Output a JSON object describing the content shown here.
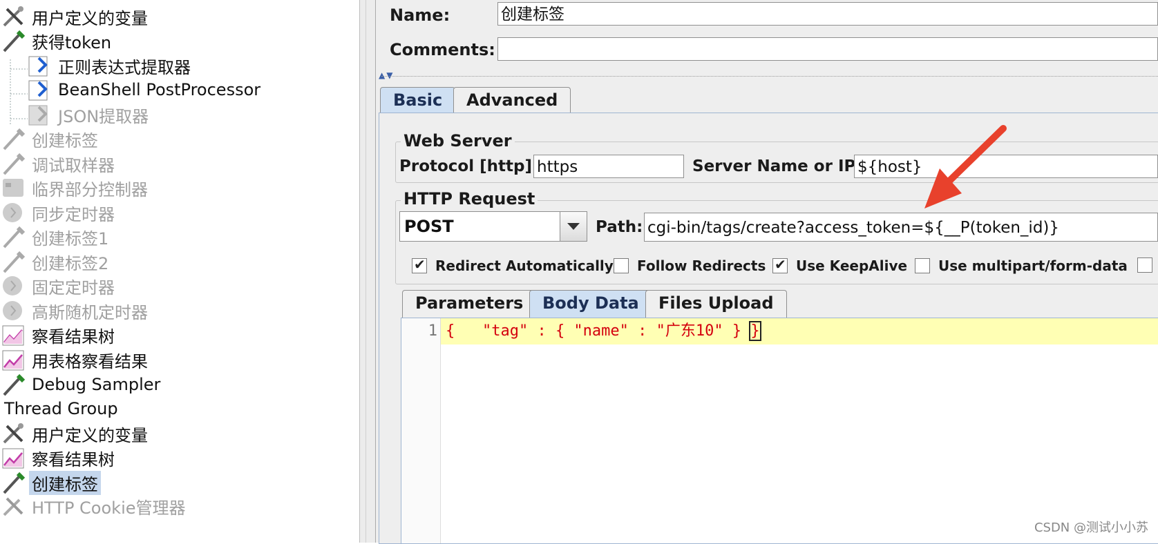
{
  "tree": {
    "items": [
      {
        "label": "用户定义的变量",
        "icon": "wrench-screwdriver-icon",
        "state": "normal"
      },
      {
        "label": "获得token",
        "icon": "pipette-sampler-icon",
        "state": "normal"
      },
      {
        "label": "正则表达式提取器",
        "icon": "post-processor-icon",
        "state": "normal"
      },
      {
        "label": "BeanShell PostProcessor",
        "icon": "post-processor-icon",
        "state": "normal"
      },
      {
        "label": "JSON提取器",
        "icon": "post-processor-icon",
        "state": "disabled"
      },
      {
        "label": "创建标签",
        "icon": "pipette-sampler-icon",
        "state": "disabled"
      },
      {
        "label": "调试取样器",
        "icon": "pipette-sampler-icon",
        "state": "disabled"
      },
      {
        "label": "临界部分控制器",
        "icon": "controller-icon",
        "state": "disabled"
      },
      {
        "label": "同步定时器",
        "icon": "timer-icon",
        "state": "disabled"
      },
      {
        "label": "创建标签1",
        "icon": "pipette-sampler-icon",
        "state": "disabled"
      },
      {
        "label": "创建标签2",
        "icon": "pipette-sampler-icon",
        "state": "disabled"
      },
      {
        "label": "固定定时器",
        "icon": "timer-icon",
        "state": "disabled"
      },
      {
        "label": "高斯随机定时器",
        "icon": "timer-icon",
        "state": "disabled"
      },
      {
        "label": "察看结果树",
        "icon": "chart-listener-icon",
        "state": "normal"
      },
      {
        "label": "用表格察看结果",
        "icon": "chart-listener-icon",
        "state": "normal"
      },
      {
        "label": "Debug Sampler",
        "icon": "pipette-sampler-icon",
        "state": "normal"
      },
      {
        "label": "Thread Group",
        "icon": "",
        "state": "normal"
      },
      {
        "label": "用户定义的变量",
        "icon": "wrench-screwdriver-icon",
        "state": "normal"
      },
      {
        "label": "察看结果树",
        "icon": "chart-listener-icon",
        "state": "normal"
      },
      {
        "label": "创建标签",
        "icon": "pipette-sampler-icon",
        "state": "selected"
      },
      {
        "label": "HTTP Cookie管理器",
        "icon": "wrench-screwdriver-icon",
        "state": "disabled"
      }
    ]
  },
  "form": {
    "name_label": "Name:",
    "name_value": "创建标签",
    "comments_label": "Comments:",
    "comments_value": ""
  },
  "tabs": {
    "basic": "Basic",
    "advanced": "Advanced"
  },
  "web_server": {
    "title": "Web Server",
    "protocol_label": "Protocol [http]:",
    "protocol_value": "https",
    "server_label": "Server Name or IP:",
    "server_value": "${host}"
  },
  "http_request": {
    "title": "HTTP Request",
    "method": "POST",
    "path_label": "Path:",
    "path_value": "cgi-bin/tags/create?access_token=${__P(token_id)}",
    "checkboxes": [
      {
        "label": "Redirect Automatically",
        "checked": true
      },
      {
        "label": "Follow Redirects",
        "checked": false
      },
      {
        "label": "Use KeepAlive",
        "checked": true
      },
      {
        "label": "Use multipart/form-data",
        "checked": false
      }
    ]
  },
  "subtabs": {
    "parameters": "Parameters",
    "body": "Body Data",
    "files": "Files Upload"
  },
  "editor": {
    "line_number": "1",
    "code_main": "{   \"tag\" : { \"name\" : \"广东10\" } ",
    "code_caret": "}"
  },
  "watermark": "CSDN @测试小小苏",
  "colors": {
    "annotation": "#e8412c",
    "selected": "#c4d6ec",
    "active_tab": "#cfe0f3"
  }
}
